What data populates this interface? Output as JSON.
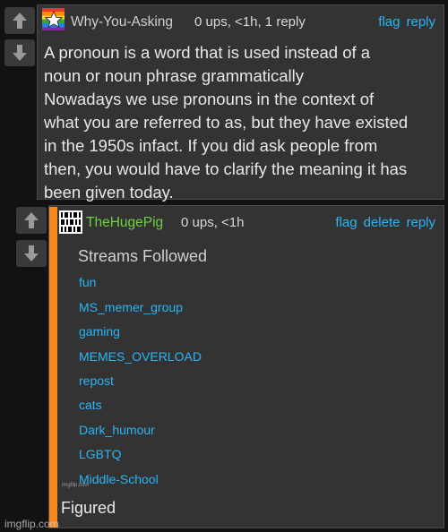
{
  "comment1": {
    "username": "Why-You-Asking",
    "meta": "0 ups, <1h, 1 reply",
    "actions": [
      "flag",
      "reply"
    ],
    "body": [
      "A pronoun is a word that is used instead of a",
      "noun or noun phrase grammatically",
      "Nowadays we use pronouns in the context of",
      "what you are referred to as, but they have existed",
      "in the 1950s infact. If you did ask people from",
      "then, you would have to clarify the meaning it has",
      "been given today."
    ]
  },
  "comment2": {
    "username": "TheHugePig",
    "meta": "0 ups, <1h",
    "actions": [
      "flag",
      "delete",
      "reply"
    ],
    "streams_title": "Streams Followed",
    "streams": [
      "fun",
      "MS_memer_group",
      "gaming",
      "MEMES_OVERLOAD",
      "repost",
      "cats",
      "Dark_humour",
      "LGBTQ",
      "Middle-School"
    ],
    "image_watermark": "imgflip.com",
    "caption": "Figured"
  },
  "footer": {
    "watermark": "imgflip.com"
  },
  "colors": {
    "link": "#29b6f6",
    "username2": "#6cd43d",
    "accent_bar": "#f58a1f",
    "panel": "#333333"
  }
}
